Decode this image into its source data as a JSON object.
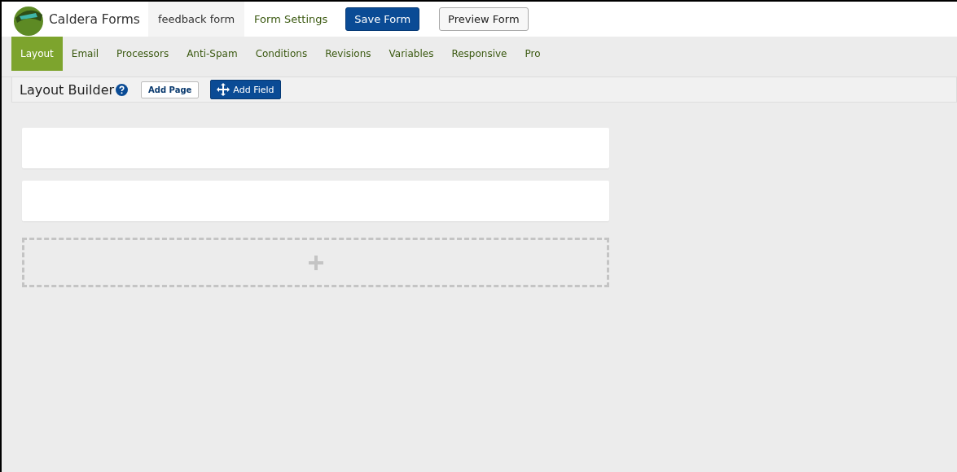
{
  "header": {
    "brand": "Caldera Forms",
    "form_name": "feedback form",
    "settings_link": "Form Settings",
    "save_button": "Save Form",
    "preview_button": "Preview Form"
  },
  "tabs": [
    {
      "label": "Layout",
      "selected": true
    },
    {
      "label": "Email",
      "selected": false
    },
    {
      "label": "Processors",
      "selected": false
    },
    {
      "label": "Anti-Spam",
      "selected": false
    },
    {
      "label": "Conditions",
      "selected": false
    },
    {
      "label": "Revisions",
      "selected": false
    },
    {
      "label": "Variables",
      "selected": false
    },
    {
      "label": "Responsive",
      "selected": false
    },
    {
      "label": "Pro",
      "selected": false
    }
  ],
  "builder": {
    "title": "Layout Builder",
    "add_page": "Add Page",
    "add_field": "Add Field"
  },
  "rows": [
    {
      "kind": "row"
    },
    {
      "kind": "row"
    },
    {
      "kind": "add-row"
    }
  ]
}
